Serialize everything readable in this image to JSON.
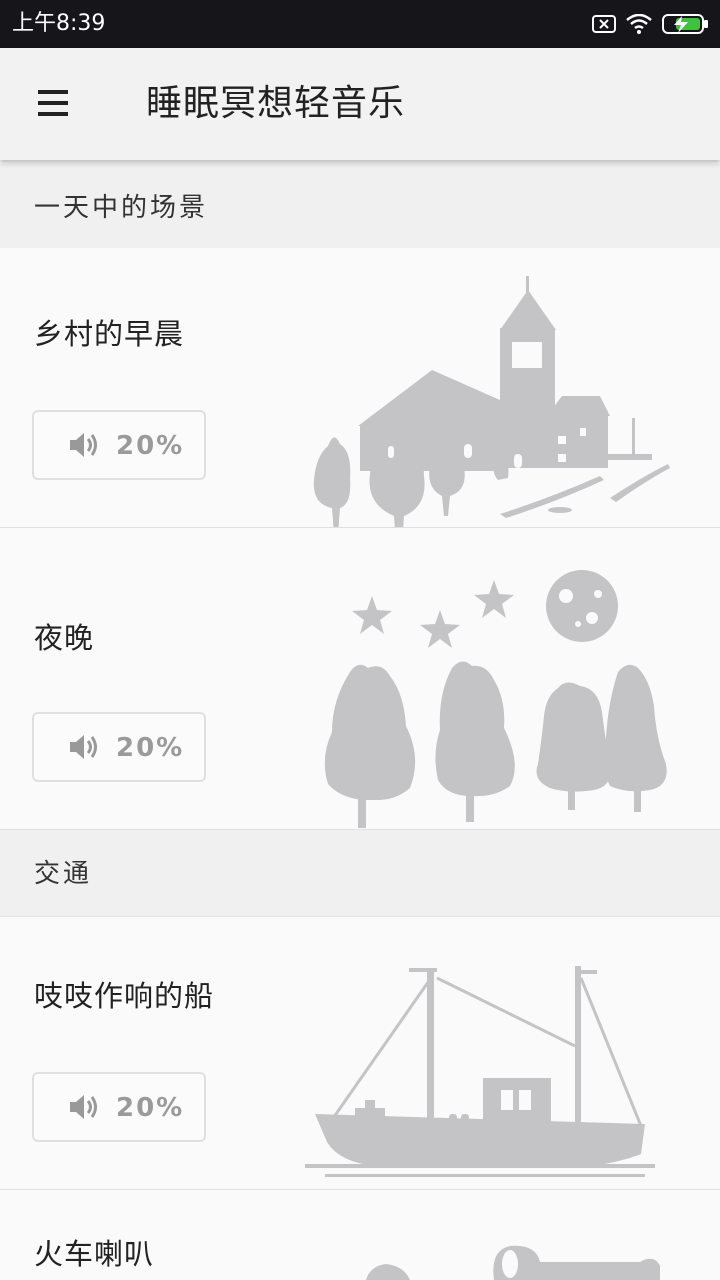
{
  "status_bar": {
    "time": "上午8:39",
    "icons": [
      "sim-off-icon",
      "wifi-icon",
      "battery-charging-icon"
    ]
  },
  "app_bar": {
    "title": "睡眠冥想轻音乐",
    "menu_icon": "hamburger-menu-icon"
  },
  "sections": [
    {
      "header": "一天中的场景",
      "items": [
        {
          "name": "乡村的早晨",
          "volume": "20%",
          "illustration": "church-village-icon"
        },
        {
          "name": "夜晚",
          "volume": "20%",
          "illustration": "night-trees-icon"
        }
      ]
    },
    {
      "header": "交通",
      "items": [
        {
          "name": "吱吱作响的船",
          "volume": "20%",
          "illustration": "boat-icon"
        },
        {
          "name": "火车喇叭",
          "illustration": "train-horn-icon"
        }
      ]
    }
  ],
  "colors": {
    "status_bar_bg": "#16161a",
    "app_bar_bg": "#f2f2f2",
    "illustration": "#c4c4c6",
    "battery_green": "#3ec23e"
  }
}
